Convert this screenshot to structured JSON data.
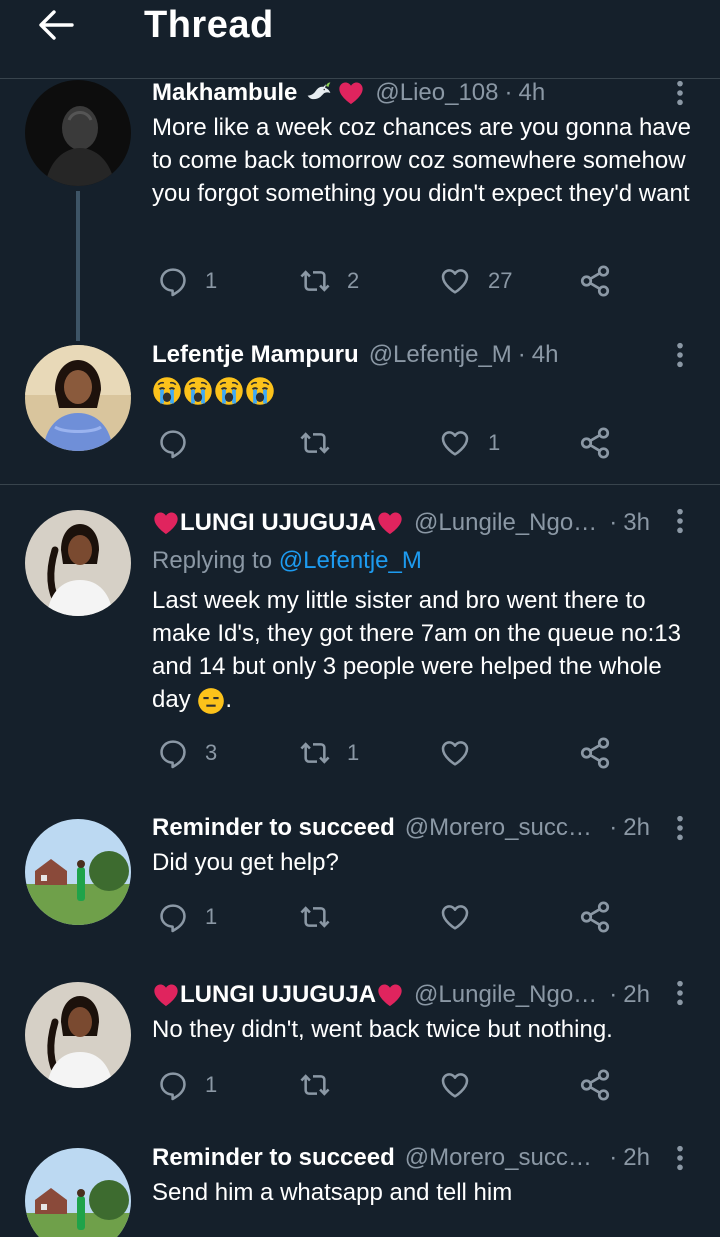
{
  "header": {
    "title": "Thread",
    "back_icon": "arrow-left-icon"
  },
  "colors": {
    "background": "#15202b",
    "secondary_text": "#8b98a5",
    "link": "#1d9bf0",
    "divider": "#38444d",
    "heart": "#e0245e"
  },
  "tweets": [
    {
      "name": "Makhambule",
      "handle": "@Lieo_108",
      "time": "4h",
      "text": "More like a week coz chances are you gonna have to come back tomorrow coz somewhere somehow you forgot something you didn't expect they'd want",
      "counts": {
        "reply": "1",
        "retweet": "2",
        "like": "27"
      }
    },
    {
      "name": "Lefentje Mampuru",
      "handle": "@Lefentje_M",
      "time": "4h",
      "text": "",
      "emoji": "4x loudly-crying-face",
      "counts": {
        "reply": "",
        "retweet": "",
        "like": "1"
      }
    },
    {
      "name": "LUNGI UJUGUJA",
      "handle": "@Lungile_Ngoma",
      "time": "3h",
      "replying_prefix": "Replying to",
      "replying_to": "@Lefentje_M",
      "text": "Last week my little sister and bro went there to make Id's, they got there 7am on the queue no:13 and 14 but only 3 people were helped the whole day",
      "text_suffix": ".",
      "counts": {
        "reply": "3",
        "retweet": "1",
        "like": ""
      }
    },
    {
      "name": "Reminder to succeed",
      "handle": "@Morero_succe...",
      "time": "2h",
      "text": "Did you get help?",
      "counts": {
        "reply": "1",
        "retweet": "",
        "like": ""
      }
    },
    {
      "name": "LUNGI UJUGUJA",
      "handle": "@Lungile_Ngoma",
      "time": "2h",
      "text": "No they didn't, went back twice but nothing.",
      "counts": {
        "reply": "1",
        "retweet": "",
        "like": ""
      }
    },
    {
      "name": "Reminder to succeed",
      "handle": "@Morero_succe...",
      "time": "2h",
      "text": "Send him a whatsapp and tell him"
    }
  ]
}
